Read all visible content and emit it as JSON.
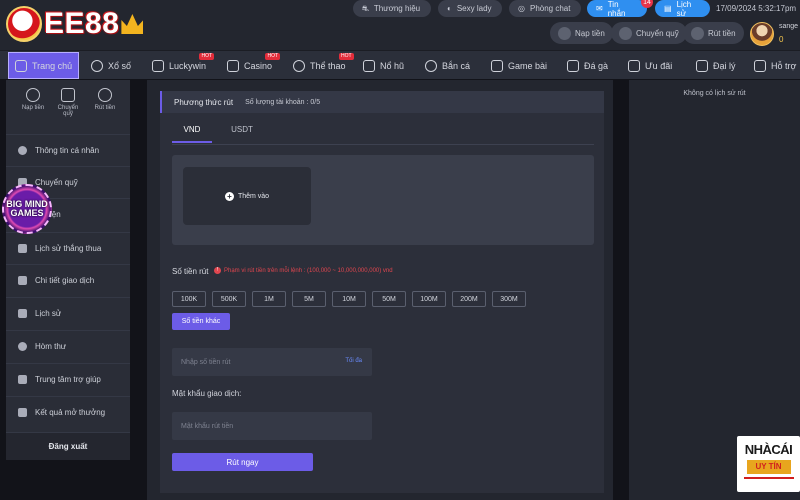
{
  "header": {
    "brand": "EE88",
    "pills": {
      "brand_story": "Thương hiệu",
      "sexy_lady": "Sexy lady",
      "chat_room": "Phòng chat",
      "messages": "Tin nhắn",
      "message_count": "14",
      "history": "Lịch sử"
    },
    "datetime": "17/09/2024 5:32:17pm",
    "quick_actions": {
      "deposit": "Nạp tiền",
      "transfer": "Chuyển quỹ",
      "withdraw": "Rút tiền"
    },
    "user": {
      "name": "sange",
      "balance": "0"
    }
  },
  "nav": {
    "items": [
      {
        "label": "Trang chủ",
        "icon": "home-icon",
        "hot": false
      },
      {
        "label": "Xổ số",
        "icon": "lottery-icon",
        "hot": false
      },
      {
        "label": "Luckywin",
        "icon": "luckywin-icon",
        "hot": true
      },
      {
        "label": "Casino",
        "icon": "casino-icon",
        "hot": true
      },
      {
        "label": "Thể thao",
        "icon": "sports-icon",
        "hot": true
      },
      {
        "label": "Nổ hũ",
        "icon": "slot-icon",
        "hot": false
      },
      {
        "label": "Bắn cá",
        "icon": "fish-icon",
        "hot": false
      },
      {
        "label": "Game bài",
        "icon": "cards-icon",
        "hot": false
      },
      {
        "label": "Đá gà",
        "icon": "cockfight-icon",
        "hot": false
      },
      {
        "label": "Ưu đãi",
        "icon": "gift-icon",
        "hot": false
      },
      {
        "label": "Đại lý",
        "icon": "agent-icon",
        "hot": false
      },
      {
        "label": "Hỗ trợ",
        "icon": "support-icon",
        "hot": false
      }
    ],
    "hot_label": "HOT"
  },
  "sidebar": {
    "quick": [
      "Nạp tiền",
      "Chuyển quỹ",
      "Rút tiền"
    ],
    "items": [
      "Thông tin cá nhân",
      "Chuyển quỹ",
      "kiện",
      "Lịch sử thắng thua",
      "Chi tiết giao dịch",
      "Lịch sử",
      "Hòm thư",
      "Trung tâm trợ giúp",
      "Kết quả mở thưởng"
    ],
    "logout": "Đăng xuất",
    "floating_badge": "BIG MIND GAMES"
  },
  "withdraw": {
    "section_title": "Phương thức rút",
    "account_count": "Số lượng tài khoản : 0/5",
    "tabs": [
      "VND",
      "USDT"
    ],
    "active_tab": "VND",
    "add_label": "Thêm vào",
    "amount_label": "Số tiền rút",
    "amount_warning": "Phạm vi rút tiền trên mỗi lệnh : (100,000 ~ 10,000,000,000) vnd",
    "chips": [
      "100K",
      "500K",
      "1M",
      "5M",
      "10M",
      "50M",
      "100M",
      "200M",
      "300M"
    ],
    "other_amount": "Số tiền khác",
    "amount_placeholder": "Nhập số tiền rút",
    "max_label": "Tối đa",
    "password_label": "Mật khẩu giao dịch:",
    "password_placeholder": "Mật khẩu rút tiền",
    "submit_label": "Rút ngay"
  },
  "right_panel": {
    "empty_history": "Không có lịch sử rút"
  },
  "watermark": {
    "line1": "NHÀCÁI",
    "line2": "UY TÍN"
  },
  "colors": {
    "accent": "#6c5ce7",
    "warning": "#e0464f",
    "link_blue": "#2f8ff0"
  }
}
